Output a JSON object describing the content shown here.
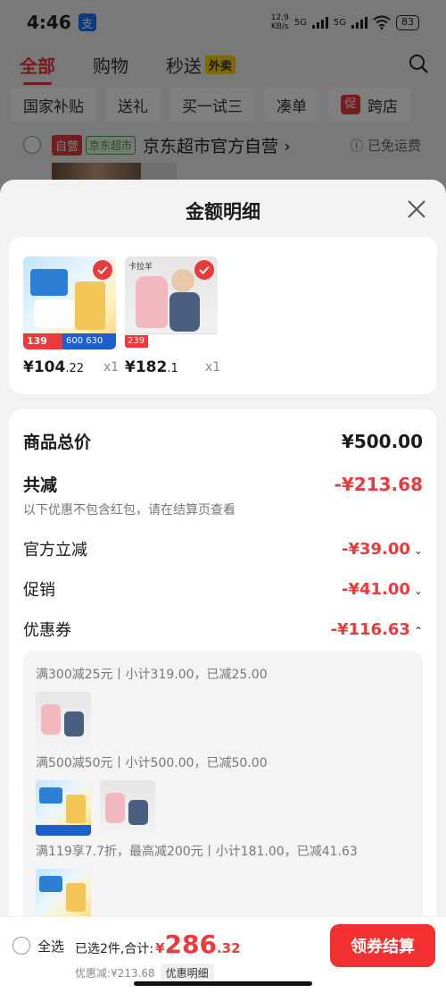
{
  "status_bar": {
    "time": "4:46",
    "app_badge": "支",
    "net_speed": "12.9",
    "net_unit": "KB/s",
    "sig1": "5G",
    "sig2": "5G",
    "battery": "83"
  },
  "top_tabs": [
    {
      "label": "全部"
    },
    {
      "label": "购物"
    },
    {
      "label": "秒送",
      "badge": "外卖"
    }
  ],
  "chips": [
    "国家补贴",
    "送礼",
    "买一试三",
    "凑单",
    "跨店"
  ],
  "chip_promo_icon": "促",
  "shop": {
    "tag_self": "自营",
    "tag_market": "京东超市",
    "name": "京东超市官方自营",
    "arrow": "›",
    "free_shipping": "ⓘ 已免运费"
  },
  "sheet": {
    "title": "金额明细",
    "products": [
      {
        "price_int": "¥104",
        "price_dec": ".22",
        "qty": "x1",
        "img_badge1": "139",
        "img_badge2": "600",
        "img_badge3": "630"
      },
      {
        "price_int": "¥182",
        "price_dec": ".1",
        "qty": "x1",
        "img_badge1": "239",
        "img_label": "卡拉羊"
      }
    ],
    "summary": {
      "total_label": "商品总价",
      "total_value": "¥500.00",
      "reduce_label": "共减",
      "reduce_value": "-¥213.68",
      "note": "以下优惠不包含红包，请在结算页查看",
      "items": [
        {
          "label": "官方立减",
          "value": "-¥39.00",
          "chevron": "⌄"
        },
        {
          "label": "促销",
          "value": "-¥41.00",
          "chevron": "⌄"
        },
        {
          "label": "优惠券",
          "value": "-¥116.63",
          "chevron": "⌃"
        }
      ]
    },
    "coupons": [
      {
        "text": "满300减25元丨小计319.00，已减25.00"
      },
      {
        "text": "满500减50元丨小计500.00，已减50.00"
      },
      {
        "text": "满119享7.7折，最高减200元丨小计181.00，已减41.63"
      }
    ]
  },
  "bottom_bar": {
    "select_all": "全选",
    "selected_text": "已选2件,合计:",
    "total_symbol": "¥",
    "total_int": "286",
    "total_dec": ".32",
    "discount_text": "优惠减:¥213.68",
    "detail_button": "优惠明细",
    "checkout_button": "领券结算"
  },
  "colors": {
    "accent": "#e93b3d",
    "checkout": "#f23030"
  }
}
